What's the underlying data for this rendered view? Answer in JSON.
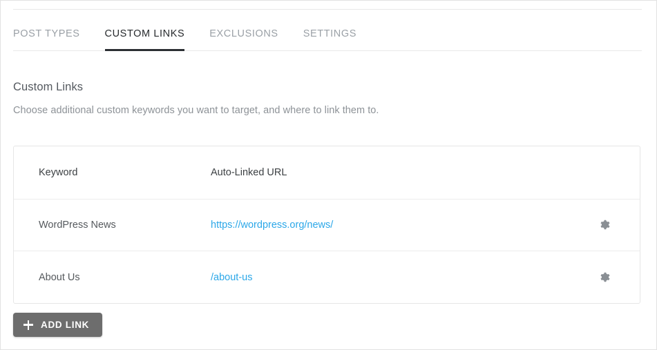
{
  "tabs": [
    {
      "label": "POST TYPES",
      "active": false
    },
    {
      "label": "CUSTOM LINKS",
      "active": true
    },
    {
      "label": "EXCLUSIONS",
      "active": false
    },
    {
      "label": "SETTINGS",
      "active": false
    }
  ],
  "section": {
    "title": "Custom Links",
    "description": "Choose additional custom keywords you want to target, and where to link them to."
  },
  "table": {
    "columns": [
      "Keyword",
      "Auto-Linked URL",
      ""
    ],
    "rows": [
      {
        "keyword": "WordPress News",
        "url": "https://wordpress.org/news/",
        "action_icon": "gear-icon"
      },
      {
        "keyword": "About Us",
        "url": "/about-us",
        "action_icon": "gear-icon"
      }
    ]
  },
  "add_button": {
    "label": "ADD LINK",
    "icon": "plus-icon"
  },
  "colors": {
    "link": "#2ba7e8",
    "active_tab_underline": "#2b2f33",
    "button_background": "#6d6d6d",
    "heading": "#54595f",
    "muted_text": "#8d9297"
  }
}
